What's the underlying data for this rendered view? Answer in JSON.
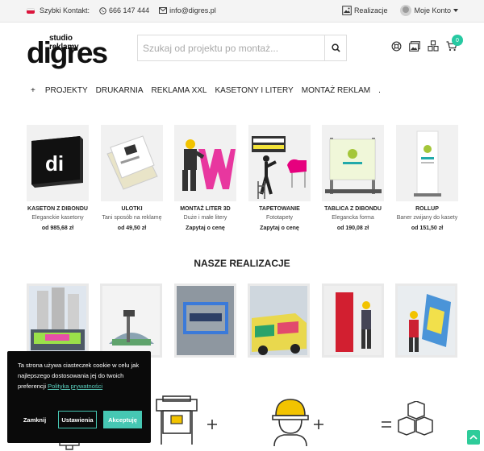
{
  "topbar": {
    "contact_label": "Szybki Kontakt:",
    "phone": "666 147 444",
    "email": "info@digres.pl",
    "realizations_label": "Realizacje",
    "account_label": "Moje Konto"
  },
  "header": {
    "logo_small": "studio reklamy",
    "logo_big": "digres",
    "search_placeholder": "Szukaj od projektu po montaż...",
    "cart_count": "0"
  },
  "nav": {
    "plus": "+",
    "items": [
      "PROJEKTY",
      "DRUKARNIA",
      "REKLAMA XXL",
      "KASETONY I LITERY",
      "MONTAŻ REKLAM",
      "."
    ]
  },
  "products": [
    {
      "name": "KASETON Z DIBONDU",
      "desc": "Eleganckie kasetony",
      "price": "od 985,68 zł",
      "icon": "lightbox-image"
    },
    {
      "name": "ULOTKI",
      "desc": "Tani sposób na reklamę",
      "price": "od 49,50 zł",
      "icon": "flyers-image"
    },
    {
      "name": "MONTAŻ LITER 3D",
      "desc": "Duże i małe litery",
      "price": "Zapytaj o cenę",
      "icon": "letters-3d-image"
    },
    {
      "name": "TAPETOWANIE",
      "desc": "Fototapety",
      "price": "Zapytaj o cenę",
      "icon": "wallpaper-image"
    },
    {
      "name": "TABLICA Z DIBONDU",
      "desc": "Elegancka forma",
      "price": "od 190,08 zł",
      "icon": "dibond-board-image"
    },
    {
      "name": "ROLLUP",
      "desc": "Baner zwijany do kasety",
      "price": "od 151,50 zł",
      "icon": "rollup-image"
    }
  ],
  "section_title": "NASZE REALIZACJE",
  "cookie": {
    "text": "Ta strona używa ciasteczek cookie w celu jak najlepszego dostosowania jej do twoich preferencji",
    "policy_link": "Polityka prywatności",
    "close_label": "Zamknij",
    "settings_label": "Ustawienia",
    "accept_label": "Akceptuję"
  },
  "colors": {
    "accent": "#46c7b3",
    "cart_badge": "#27c9a2",
    "cookie_bg": "#0a0a0a"
  }
}
